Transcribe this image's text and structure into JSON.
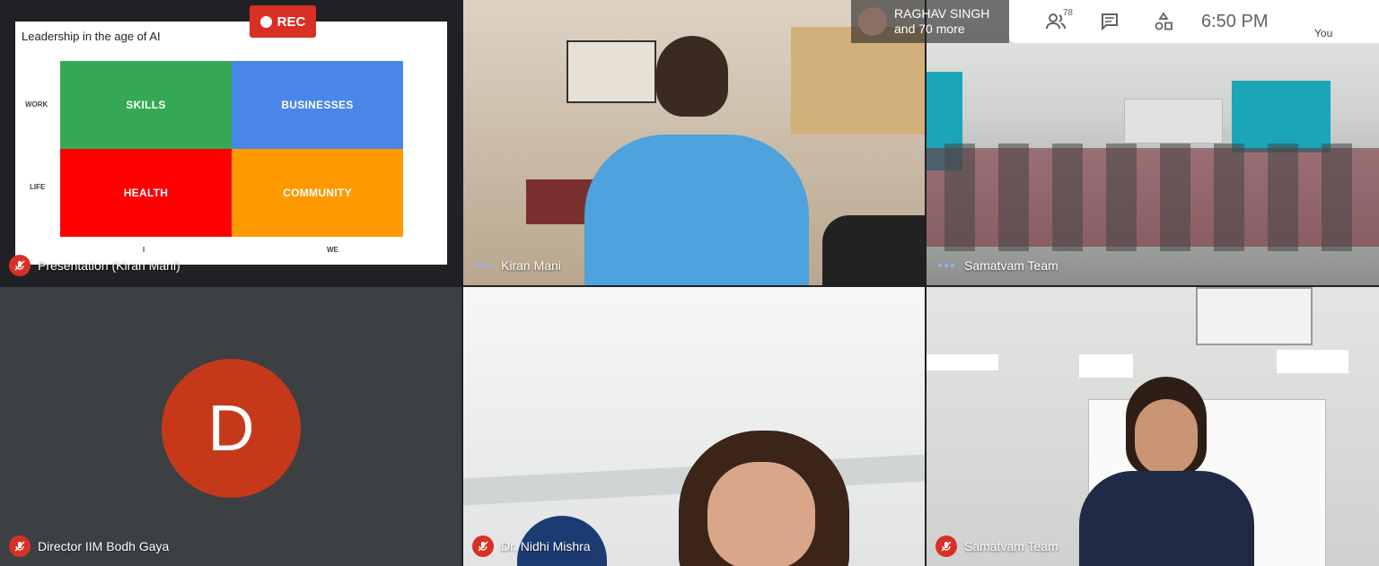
{
  "recording": {
    "label": "REC",
    "color": "#d93025"
  },
  "topbar": {
    "presenter_name": "RAGHAV SINGH",
    "presenter_more": "and 70 more",
    "people_count": "78",
    "time": "6:50  PM",
    "you_label": "You"
  },
  "slide": {
    "title": "Leadership in the age of AI",
    "row_labels": [
      "WORK",
      "LIFE"
    ],
    "col_labels": [
      "I",
      "WE"
    ],
    "cells": [
      {
        "label": "SKILLS",
        "color": "#34a853"
      },
      {
        "label": "BUSINESSES",
        "color": "#4a86e8"
      },
      {
        "label": "HEALTH",
        "color": "#ff0000"
      },
      {
        "label": "COMMUNITY",
        "color": "#ff9900"
      }
    ]
  },
  "tiles": [
    {
      "name": "Presentation (Kiran Mani)",
      "status": "mic-off-icon"
    },
    {
      "name": "Kiran Mani",
      "status": "speaking-dots-icon"
    },
    {
      "name": "Samatvam Team",
      "status": "speaking-dots-icon"
    },
    {
      "name": "Director IIM Bodh Gaya",
      "status": "mic-off-icon",
      "avatar_letter": "D"
    },
    {
      "name": "Dr. Nidhi Mishra",
      "status": "mic-off-icon"
    },
    {
      "name": "Samatvam Team",
      "status": "mic-off-icon"
    }
  ]
}
